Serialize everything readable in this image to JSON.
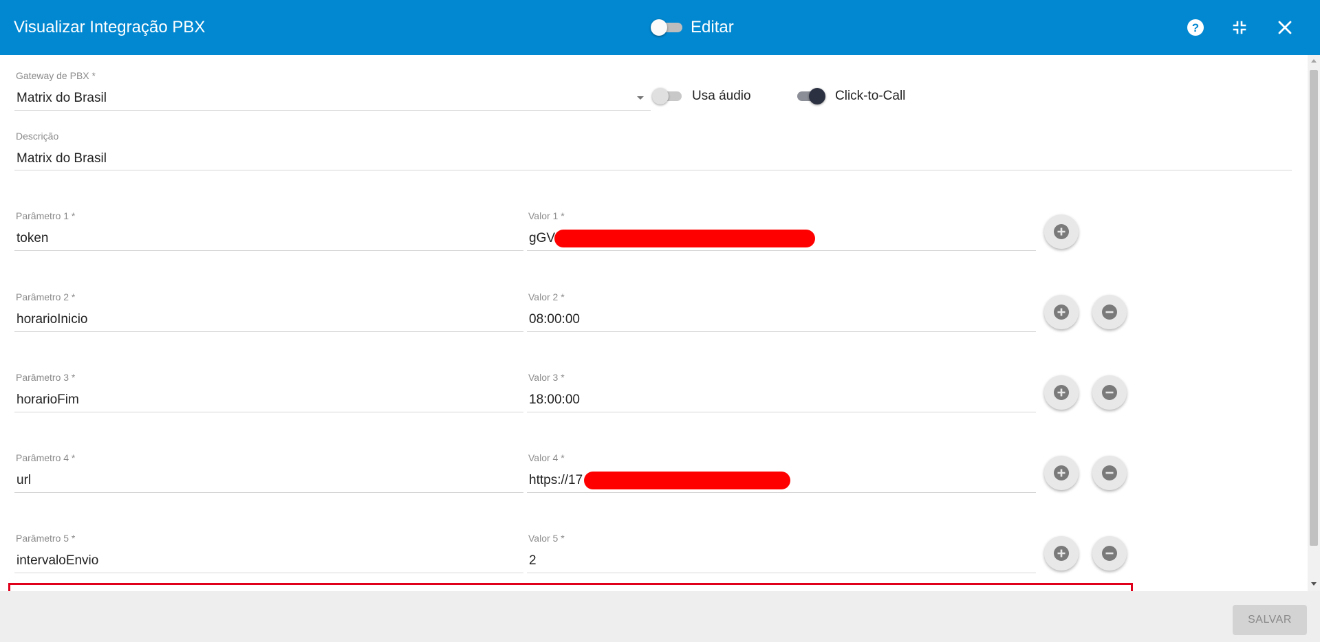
{
  "header": {
    "title": "Visualizar Integração PBX",
    "edit_label": "Editar"
  },
  "form": {
    "gateway": {
      "label": "Gateway de PBX *",
      "value": "Matrix do Brasil"
    },
    "usa_audio": {
      "label": "Usa áudio",
      "checked": false
    },
    "click_to_call": {
      "label": "Click-to-Call",
      "checked": true
    },
    "descricao": {
      "label": "Descrição",
      "value": "Matrix do Brasil"
    },
    "params": [
      {
        "param_label": "Parâmetro 1 *",
        "param_value": "token",
        "valor_label": "Valor 1 *",
        "valor_value": "gGV"
      },
      {
        "param_label": "Parâmetro 2 *",
        "param_value": "horarioInicio",
        "valor_label": "Valor 2 *",
        "valor_value": "08:00:00"
      },
      {
        "param_label": "Parâmetro 3 *",
        "param_value": "horarioFim",
        "valor_label": "Valor 3 *",
        "valor_value": "18:00:00"
      },
      {
        "param_label": "Parâmetro 4 *",
        "param_value": "url",
        "valor_label": "Valor 4 *",
        "valor_value": "https://17"
      },
      {
        "param_label": "Parâmetro 5 *",
        "param_value": "intervaloEnvio",
        "valor_label": "Valor 5 *",
        "valor_value": "2"
      }
    ]
  },
  "footer": {
    "save_label": "SALVAR"
  },
  "colors": {
    "header_bg": "#0288d1",
    "redaction": "#ff0000",
    "highlight": "#e0001b"
  }
}
